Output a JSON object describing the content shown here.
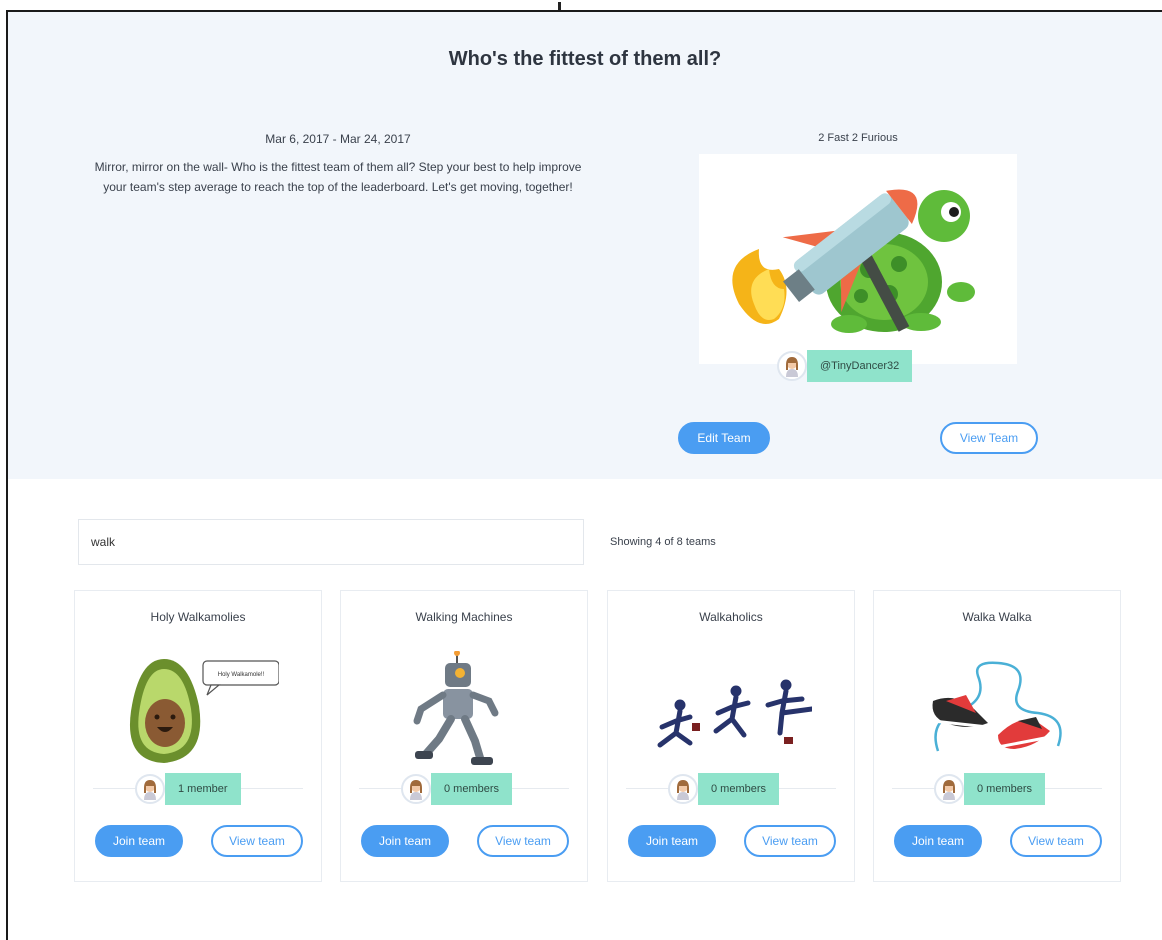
{
  "hero": {
    "title": "Who's the fittest of them all?",
    "challenge": {
      "dates": "Mar 6, 2017 - Mar 24, 2017",
      "description": "Mirror, mirror on the wall- Who is the fittest team of them all? Step your best to help improve your team's step average to reach the top of the leaderboard. Let's get moving, together!"
    },
    "my_team": {
      "name": "2 Fast 2 Furious",
      "captain_handle": "@TinyDancer32",
      "edit_label": "Edit Team",
      "view_label": "View Team"
    }
  },
  "search": {
    "value": "walk",
    "results_text": "Showing 4 of 8 teams"
  },
  "teams": [
    {
      "name": "Holy Walkamolies",
      "members": "1 member",
      "speech": "Holy Walkamole!!",
      "join_label": "Join team",
      "view_label": "View team"
    },
    {
      "name": "Walking Machines",
      "members": "0 members",
      "join_label": "Join team",
      "view_label": "View team"
    },
    {
      "name": "Walkaholics",
      "members": "0 members",
      "join_label": "Join team",
      "view_label": "View team"
    },
    {
      "name": "Walka Walka",
      "members": "0 members",
      "join_label": "Join team",
      "view_label": "View team"
    }
  ],
  "colors": {
    "primary": "#4a9df2",
    "badge": "#8fe3cb",
    "hero_bg": "#f2f6fb"
  },
  "icons": [
    "user-avatar-icon",
    "rocket-turtle-illustration",
    "avocado-illustration",
    "robot-illustration",
    "runners-illustration",
    "sneakers-illustration"
  ]
}
